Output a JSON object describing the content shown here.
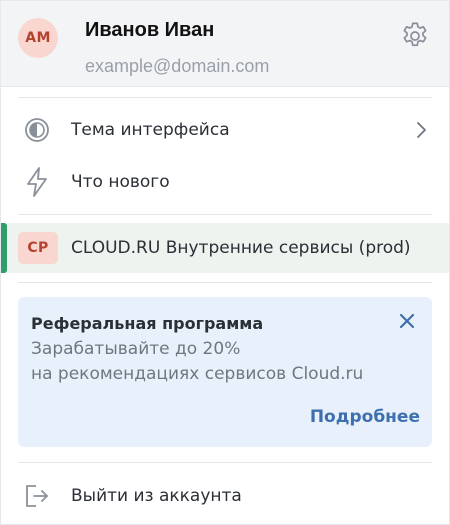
{
  "profile": {
    "initials": "АМ",
    "name": "Иванов Иван",
    "email": "example@domain.com"
  },
  "menu": {
    "items": [
      {
        "label": "Тема интерфейса",
        "icon": "theme-icon"
      },
      {
        "label": "Что нового",
        "icon": "lightning-icon"
      }
    ]
  },
  "project": {
    "badge": "CP",
    "label": "CLOUD.RU Внутренние сервисы (prod)"
  },
  "promo": {
    "title": "Реферальная программа",
    "line1": "Зарабатывайте до 20%",
    "line2": "на рекомендациях сервисов Cloud.ru",
    "link": "Подробнее"
  },
  "logout": {
    "label": "Выйти из аккаунта",
    "icon": "logout-icon"
  },
  "colors": {
    "accent": "#2f9d6a",
    "link": "#3e6fae",
    "badge_bg": "#f9d6d0",
    "badge_text": "#b3422f",
    "promo_bg": "#e8f1fb"
  }
}
